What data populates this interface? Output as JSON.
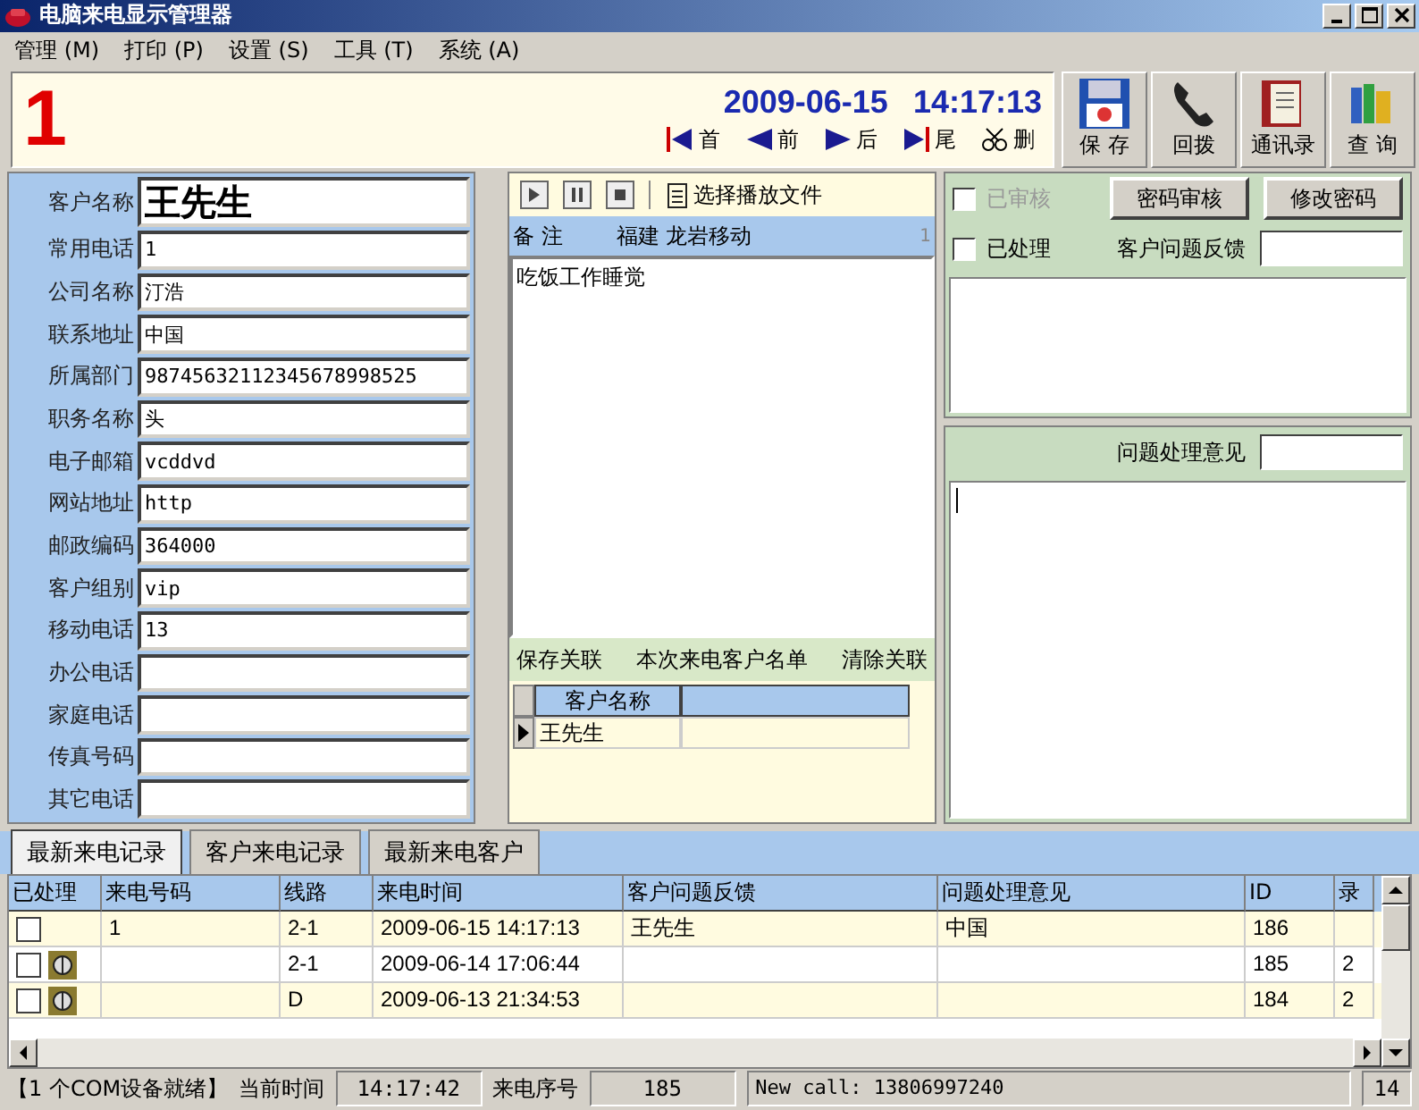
{
  "window": {
    "title": "电脑来电显示管理器"
  },
  "menu": [
    "管理 (M)",
    "打印 (P)",
    "设置 (S)",
    "工具 (T)",
    "系统 (A)"
  ],
  "caller": {
    "number": "1",
    "date": "2009-06-15",
    "time": "14:17:13"
  },
  "nav": [
    {
      "kind": "first",
      "label": "首"
    },
    {
      "kind": "prev",
      "label": "前"
    },
    {
      "kind": "next",
      "label": "后"
    },
    {
      "kind": "last",
      "label": "尾"
    },
    {
      "kind": "delete",
      "label": "删"
    }
  ],
  "toolbar": [
    {
      "kind": "save",
      "label": "保 存"
    },
    {
      "kind": "phone",
      "label": "回拨"
    },
    {
      "kind": "book",
      "label": "通讯录"
    },
    {
      "kind": "query",
      "label": "查 询"
    }
  ],
  "fields": [
    {
      "kind": "name",
      "label": "客户名称",
      "value": "王先生"
    },
    {
      "kind": "text",
      "label": "常用电话",
      "value": "1"
    },
    {
      "kind": "text",
      "label": "公司名称",
      "value": "汀浩"
    },
    {
      "kind": "text",
      "label": "联系地址",
      "value": "中国"
    },
    {
      "kind": "text",
      "label": "所属部门",
      "value": "98745632112345678998525"
    },
    {
      "kind": "text",
      "label": "职务名称",
      "value": "头"
    },
    {
      "kind": "text",
      "label": "电子邮箱",
      "value": "vcddvd"
    },
    {
      "kind": "text",
      "label": "网站地址",
      "value": "http"
    },
    {
      "kind": "text",
      "label": "邮政编码",
      "value": "364000"
    },
    {
      "kind": "text",
      "label": "客户组别",
      "value": "vip"
    },
    {
      "kind": "text",
      "label": "移动电话",
      "value": "13"
    },
    {
      "kind": "text",
      "label": "办公电话"
    },
    {
      "kind": "text",
      "label": "家庭电话"
    },
    {
      "kind": "text",
      "label": "传真号码"
    },
    {
      "kind": "text",
      "label": "其它电话"
    }
  ],
  "player": {
    "select_file": "选择播放文件"
  },
  "notes": {
    "label": "备 注",
    "location": "福建 龙岩移动",
    "page": "1",
    "text": "吃饭工作睡觉"
  },
  "relations": {
    "actions": [
      "保存关联",
      "本次来电客户名单",
      "清除关联"
    ],
    "columns": [
      "客户名称"
    ],
    "rows": [
      {
        "name": "王先生",
        "selected": true
      }
    ]
  },
  "review": {
    "checks": [
      {
        "label": "已审核",
        "checked": false,
        "disabled": true
      },
      {
        "label": "已处理",
        "checked": false,
        "disabled": false
      }
    ],
    "buttons": [
      "密码审核",
      "修改密码"
    ],
    "feedback_label": "客户问题反馈",
    "opinion_label": "问题处理意见"
  },
  "tabs": [
    {
      "label": "最新来电记录",
      "selected": true
    },
    {
      "label": "客户来电记录",
      "selected": false
    },
    {
      "label": "最新来电客户",
      "selected": false
    }
  ],
  "grid": {
    "columns": [
      "已处理",
      "来电号码",
      "线路",
      "来电时间",
      "客户问题反馈",
      "问题处理意见",
      "ID",
      "录"
    ],
    "rows": [
      {
        "processed": false,
        "recording": false,
        "number": "1",
        "line": "2-1",
        "time": "2009-06-15 14:17:13",
        "feedback": "王先生",
        "opinion": "中国",
        "id": "186",
        "column_8": ""
      },
      {
        "processed": false,
        "recording": true,
        "number": "",
        "line": "2-1",
        "time": "2009-06-14 17:06:44",
        "feedback": "",
        "opinion": "",
        "id": "185",
        "column_8": "2"
      },
      {
        "processed": false,
        "recording": true,
        "number": "",
        "line": "D",
        "time": "2009-06-13 21:34:53",
        "feedback": "",
        "opinion": "",
        "id": "184",
        "column_8": "2"
      }
    ]
  },
  "status": {
    "ready": "【1 个COM设备就绪】",
    "time_label": "当前时间",
    "time": "14:17:42",
    "seq_label": "来电序号",
    "seq": "185",
    "message": "New call: 13806997240",
    "extra": "14"
  }
}
